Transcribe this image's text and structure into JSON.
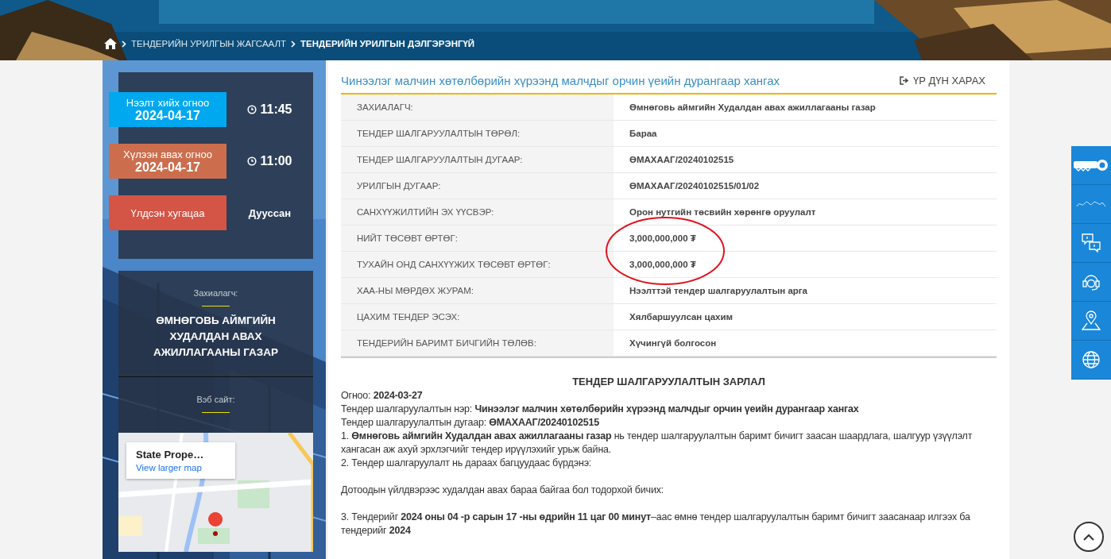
{
  "breadcrumb": [
    {
      "label": "ТЕНДЕРИЙН УРИЛГЫН ЖАГСААЛТ",
      "current": false
    },
    {
      "label": "ТЕНДЕРИЙН УРИЛГЫН ДЭЛГЭРЭНГҮЙ",
      "current": true
    }
  ],
  "schedule": [
    {
      "kind": "date",
      "label": "Нээлт хийх огноо",
      "date": "2024-04-17",
      "time": "11:45",
      "color": "#00a8f0"
    },
    {
      "kind": "date",
      "label": "Хүлээн авах огноо",
      "date": "2024-04-17",
      "time": "11:00",
      "color": "#cc6e4e"
    },
    {
      "kind": "status",
      "label": "Үлдсэн хугацаа",
      "value": "Дууссан",
      "color": "#d45445"
    }
  ],
  "customer": {
    "label": "Захиалагч:",
    "name": "ӨМНӨГОВЬ АЙМГИЙН ХУДАЛДАН АВАХ АЖИЛЛАГААНЫ ГАЗАР"
  },
  "website": {
    "label": "Вэб сайт:"
  },
  "map": {
    "place": "State Prope…",
    "link": "View larger map"
  },
  "tender": {
    "title": "Чинээлэг малчин хөтөлбөрийн хүрээнд малчдыг орчин үеийн дурангаар хангах",
    "result_button": "ҮР ДҮН ХАРАХ",
    "details": [
      {
        "label": "ЗАХИАЛАГЧ:",
        "value": "Өмнөговь аймгийн Худалдан авах ажиллагааны газар",
        "circled": false
      },
      {
        "label": "ТЕНДЕР ШАЛГАРУУЛАЛТЫН ТӨРӨЛ:",
        "value": "Бараа",
        "circled": false
      },
      {
        "label": "ТЕНДЕР ШАЛГАРУУЛАЛТЫН ДУГААР:",
        "value": "ӨМАХААГ/20240102515",
        "circled": false
      },
      {
        "label": "УРИЛГЫН ДУГААР:",
        "value": "ӨМАХААГ/20240102515/01/02",
        "circled": false
      },
      {
        "label": "САНХҮҮЖИЛТИЙН ЭХ ҮҮСВЭР:",
        "value": "Орон нутгийн төсвийн хөрөнгө оруулалт",
        "circled": false
      },
      {
        "label": "НИЙТ ТӨСӨВТ ӨРТӨГ:",
        "value": "3,000,000,000 ₮",
        "circled": true
      },
      {
        "label": "ТУХАЙН ОНД САНХҮҮЖИХ ТӨСӨВТ ӨРТӨГ:",
        "value": "3,000,000,000 ₮",
        "circled": true
      },
      {
        "label": "ХАА-НЫ МӨРДӨХ ЖУРАМ:",
        "value": "Нээлттэй тендер шалгаруулалтын арга",
        "circled": false
      },
      {
        "label": "ЦАХИМ ТЕНДЕР ЭСЭХ:",
        "value": "Хялбаршуулсан цахим",
        "circled": false
      },
      {
        "label": "ТЕНДЕРИЙН БАРИМТ БИЧГИЙН ТӨЛӨВ:",
        "value": "Хүчингүй болгосон",
        "circled": false
      }
    ]
  },
  "announcement": {
    "heading": "ТЕНДЕР ШАЛГАРУУЛАЛТЫН ЗАРЛАЛ",
    "blocks": [
      [
        "Огноо: **2024-03-27**",
        "Тендер шалгаруулалтын нэр: **Чинээлэг малчин хөтөлбөрийн хүрээнд малчдыг орчин үеийн дурангаар хангах**",
        "Тендер шалгаруулалтын дугаар: **ӨМАХААГ/20240102515**",
        "1. **Өмнөговь аймгийн Худалдан авах ажиллагааны газар** нь тендер шалгаруулалтын баримт бичигт заасан шаардлага, шалгуур үзүүлэлт хангасан аж ахуй эрхлэгчийг тендер ирүүлэхийг урьж байна.",
        "2. Тендер шалгаруулалт нь дараах багцуудаас бүрдэнэ:"
      ],
      [
        "Дотоодын үйлдвэрээс худалдан авах бараа байгаа бол тодорхой бичих:"
      ],
      [
        "3. Тендерийг **2024 оны 04 -р сарын 17 -ны өдрийн 11 цаг 00 минут**–аас өмнө тендер шалгаруулалтын баримт бичигт заасанаар илгээх ба тендерийг **2024**"
      ]
    ]
  },
  "side_toolbar": [
    {
      "kind": "key-logo"
    },
    {
      "kind": "signature-logo"
    },
    {
      "kind": "chat"
    },
    {
      "kind": "support"
    },
    {
      "kind": "location"
    },
    {
      "kind": "globe"
    }
  ]
}
